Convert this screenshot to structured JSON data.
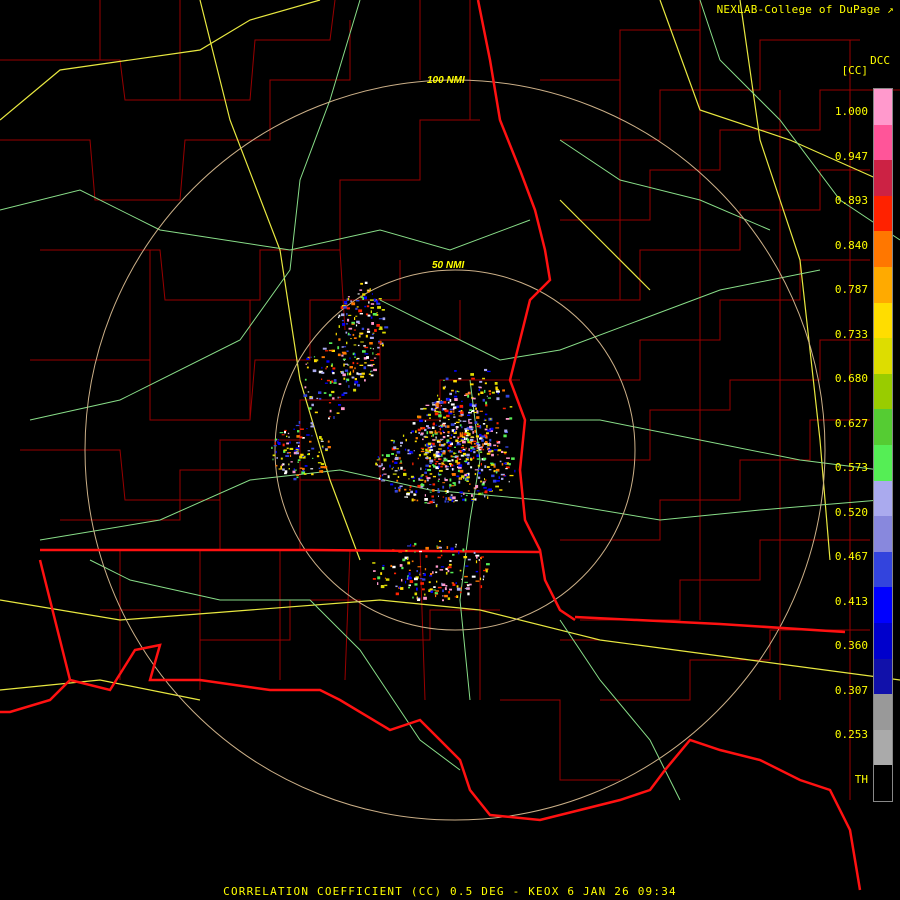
{
  "header": {
    "credit": "NEXLAB-College of DuPage"
  },
  "footer": {
    "caption": "CORRELATION COEFFICIENT (CC) 0.5 DEG - KEOX 6 JAN 26 09:34"
  },
  "range_rings": [
    {
      "label": "50 NMI"
    },
    {
      "label": "100 NMI"
    }
  ],
  "legend": {
    "product": "DCC",
    "units": "[CC]",
    "ticks": [
      "1.000",
      "0.947",
      "0.893",
      "0.840",
      "0.787",
      "0.733",
      "0.680",
      "0.627",
      "0.573",
      "0.520",
      "0.467",
      "0.413",
      "0.360",
      "0.307",
      "0.253",
      "TH"
    ],
    "colors": [
      "#ff99cc",
      "#ff5599",
      "#cc2244",
      "#ff2200",
      "#ff7700",
      "#ffaa00",
      "#ffdd00",
      "#dddd00",
      "#99cc00",
      "#55cc33",
      "#55ee55",
      "#aaaaee",
      "#8888dd",
      "#3344dd",
      "#0000ff",
      "#0000cc",
      "#1111aa",
      "#999999",
      "#aaaaaa",
      "#000000"
    ]
  },
  "icons": {
    "credit_icon": "external-link-icon"
  }
}
